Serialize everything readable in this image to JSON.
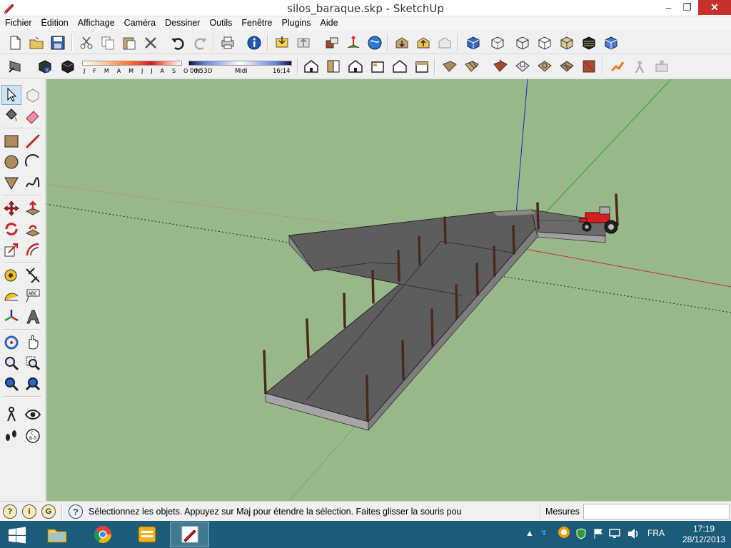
{
  "window": {
    "title": "silos_baraque.skp - SketchUp",
    "minimize": "–",
    "restore": "❐",
    "close": "✕"
  },
  "menu": [
    "Fichier",
    "Édition",
    "Affichage",
    "Caméra",
    "Dessiner",
    "Outils",
    "Fenêtre",
    "Plugins",
    "Aide"
  ],
  "shadows": {
    "months": "J F M A M J J A S O N D",
    "time_start": "06:53",
    "time_mid": "Midi",
    "time_end": "16:14"
  },
  "status": {
    "message": "Sélectionnez les objets. Appuyez sur Maj pour étendre la sélection. Faites glisser la souris pou",
    "measures_label": "Mesures",
    "measures_value": ""
  },
  "taskbar": {
    "language": "FRA",
    "time": "17:19",
    "date": "28/12/2013"
  },
  "colors": {
    "viewport": "#99b889",
    "slab_top": "#5f5f5f",
    "slab_side": "#9a9a9a",
    "post": "#6b3b26",
    "axis_red": "#c83030",
    "axis_green": "#2ea02e",
    "axis_blue": "#2020c8",
    "tractor": "#d42020",
    "taskbar": "#1c5c7a"
  }
}
